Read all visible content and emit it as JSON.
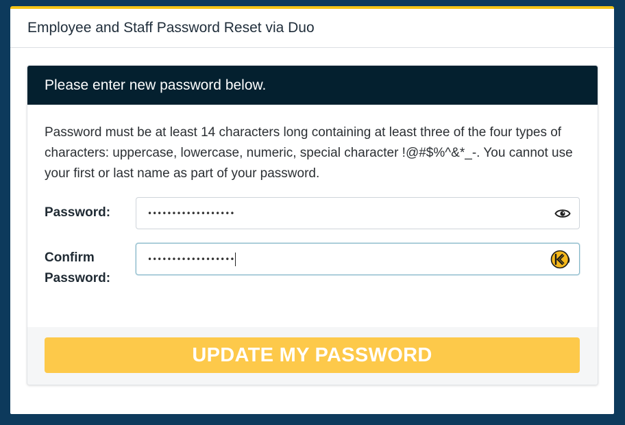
{
  "page": {
    "title": "Employee and Staff Password Reset via Duo"
  },
  "panel": {
    "heading": "Please enter new password below.",
    "instructions": "Password must be at least 14 characters long containing at least three of the four types of characters: uppercase, lowercase, numeric, special character !@#$%^&*_-. You cannot use your first or last name as part of your password."
  },
  "form": {
    "password_label": "Password:",
    "password_value": "••••••••••••••••••",
    "confirm_label_line1": "Confirm",
    "confirm_label_line2": "Password:",
    "confirm_value": "••••••••••••••••••",
    "submit_label": "UPDATE MY PASSWORD"
  },
  "icons": {
    "password_toggle": "eye-icon",
    "password_manager": "keeper-icon"
  },
  "colors": {
    "background": "#0d3a5c",
    "accent_top": "#f5c518",
    "panel_header": "#04202f",
    "button": "#fdc94a"
  }
}
